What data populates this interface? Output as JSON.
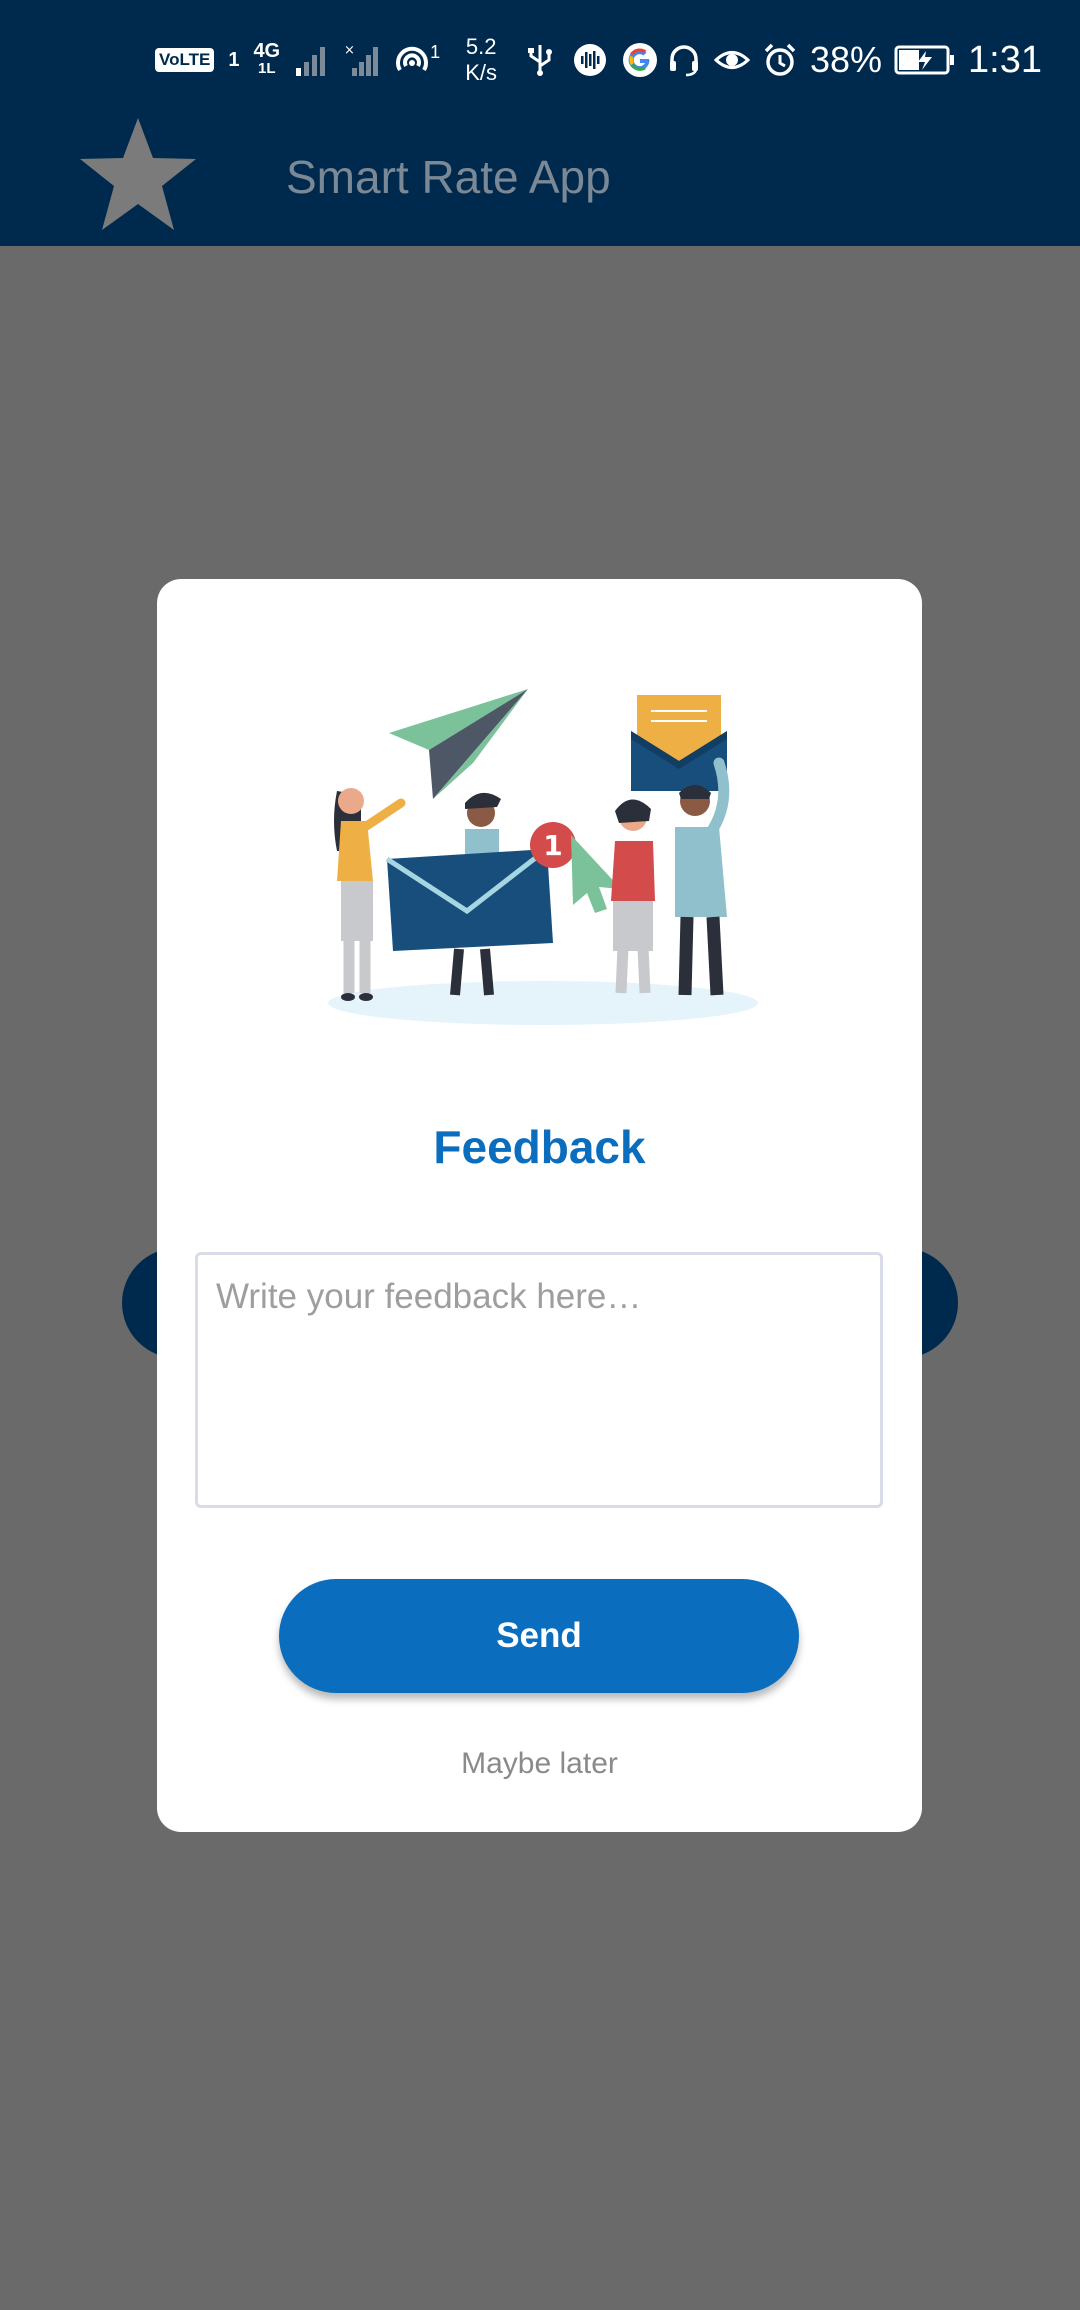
{
  "status_bar": {
    "volte_label": "VoLTE",
    "sim1_label": "1",
    "network_label": "4G",
    "network_sub_label": "1L",
    "hotspot_count": "1",
    "speed_value": "5.2",
    "speed_unit": "K/s",
    "battery_percent": "38%",
    "time": "1:31",
    "icons": [
      "signal-icon",
      "hotspot-icon",
      "usb-icon",
      "audio-icon",
      "google-icon",
      "headset-icon",
      "eye-icon",
      "alarm-icon",
      "battery-icon"
    ]
  },
  "app_bar": {
    "title": "Smart Rate App",
    "icon": "star-icon"
  },
  "dialog": {
    "title": "Feedback",
    "input_placeholder": "Write your feedback here…",
    "input_value": "",
    "send_label": "Send",
    "later_label": "Maybe later",
    "illustration": "feedback-people-illustration"
  },
  "colors": {
    "app_bar_bg": "#002a4d",
    "accent": "#0a6dbd",
    "scrim": "#6a6a6a",
    "muted_text": "#8a8a8a"
  }
}
